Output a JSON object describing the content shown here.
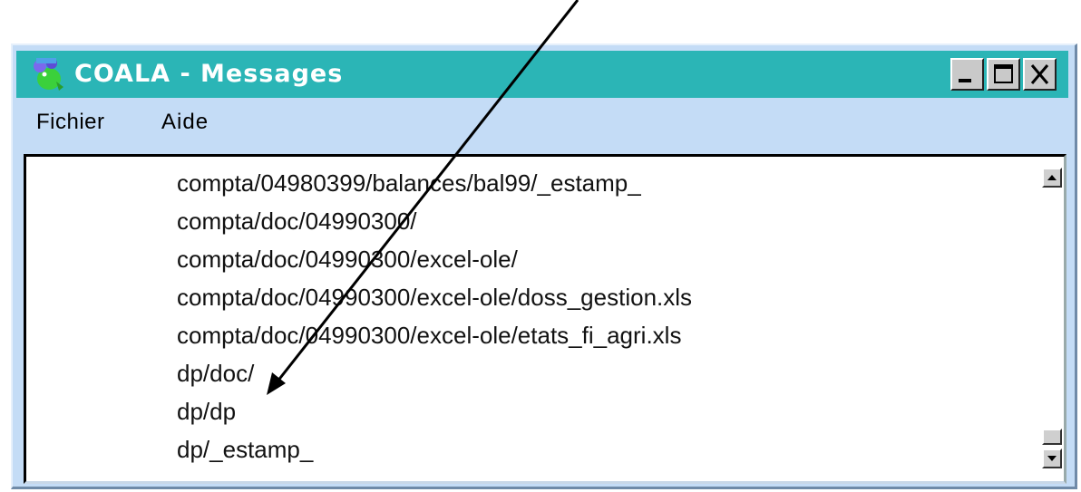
{
  "window": {
    "title": "COALA - Messages",
    "icon": "coala-app-icon",
    "controls": {
      "minimize_icon": "minimize-icon",
      "maximize_icon": "maximize-icon",
      "close_icon": "close-icon"
    }
  },
  "menu": {
    "items": [
      {
        "label": "Fichier"
      },
      {
        "label": "Aide"
      }
    ]
  },
  "messages": {
    "lines": [
      "compta/04980399/balances/bal99/_estamp_",
      "compta/doc/04990300/",
      "compta/doc/04990300/excel-ole/",
      "compta/doc/04990300/excel-ole/doss_gestion.xls",
      "compta/doc/04990300/excel-ole/etats_fi_agri.xls",
      "dp/doc/",
      "dp/dp",
      "dp/_estamp_"
    ]
  },
  "colors": {
    "titlebar": "#2bb5b6",
    "window_frame": "#c4dcf6",
    "title_text": "#ffffff",
    "annotation_arrow": "#000000"
  }
}
